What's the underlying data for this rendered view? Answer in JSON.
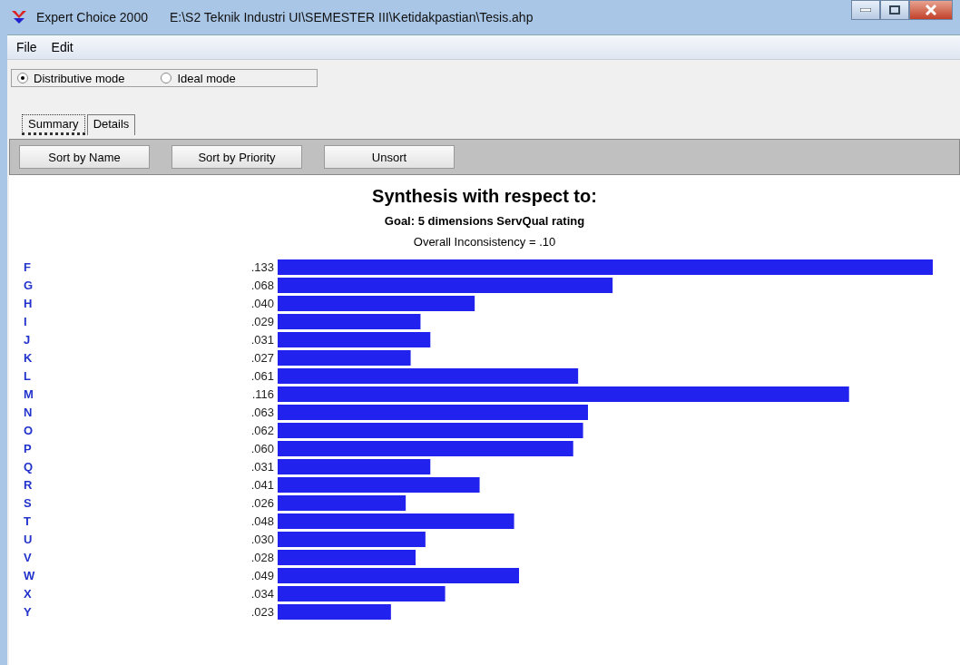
{
  "window": {
    "title": "Expert Choice 2000",
    "file_path": "E:\\S2 Teknik Industri UI\\SEMESTER III\\Ketidakpastian\\Tesis.ahp"
  },
  "menu": [
    "File",
    "Edit"
  ],
  "modes": [
    {
      "label": "Distributive mode",
      "selected": true
    },
    {
      "label": "Ideal mode",
      "selected": false
    }
  ],
  "tabs": [
    {
      "label": "Summary",
      "selected": true
    },
    {
      "label": "Details",
      "selected": false
    }
  ],
  "toolbar": [
    "Sort by Name",
    "Sort by Priority",
    "Unsort"
  ],
  "synthesis": {
    "heading": "Synthesis with respect to:",
    "goal": "Goal: 5 dimensions ServQual rating",
    "inconsistency": "Overall Inconsistency = .10",
    "chart_data": {
      "type": "bar",
      "orientation": "horizontal",
      "categories": [
        "F",
        "G",
        "H",
        "I",
        "J",
        "K",
        "L",
        "M",
        "N",
        "O",
        "P",
        "Q",
        "R",
        "S",
        "T",
        "U",
        "V",
        "W",
        "X",
        "Y"
      ],
      "series": [
        {
          "color": "#2222ee",
          "values": [
            0.133,
            0.068,
            0.04,
            0.029,
            0.031,
            0.027,
            0.061,
            0.116,
            0.063,
            0.062,
            0.06,
            0.031,
            0.041,
            0.026,
            0.048,
            0.03,
            0.028,
            0.049,
            0.034,
            0.023
          ],
          "value_labels": [
            ".133",
            ".068",
            ".040",
            ".029",
            ".031",
            ".027",
            ".061",
            ".116",
            ".063",
            ".062",
            ".060",
            ".031",
            ".041",
            ".026",
            ".048",
            ".030",
            ".028",
            ".049",
            ".034",
            ".023"
          ]
        }
      ]
    }
  }
}
